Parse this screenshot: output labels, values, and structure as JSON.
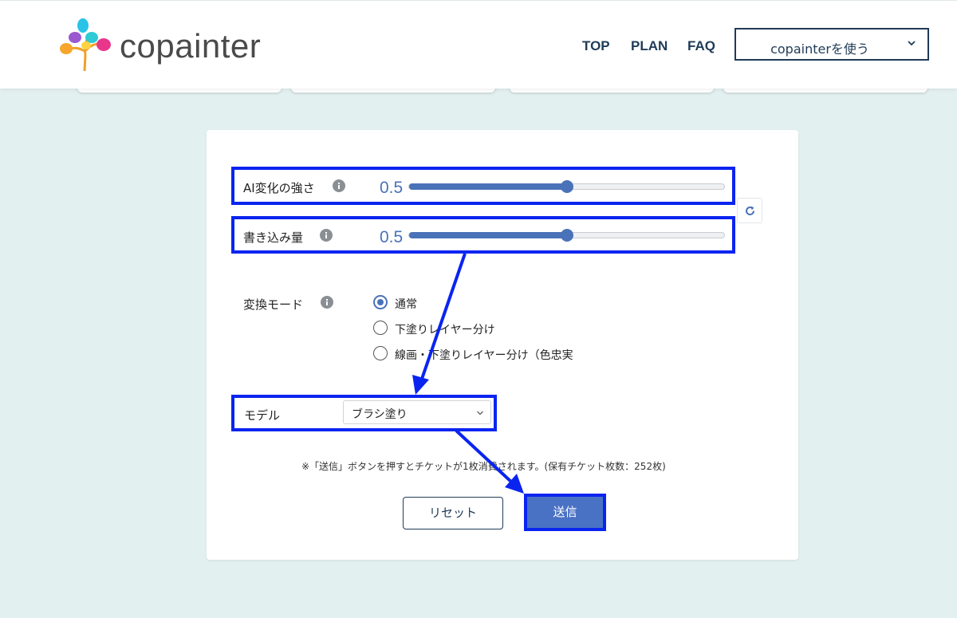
{
  "header": {
    "brand": "copainter",
    "nav": [
      "TOP",
      "PLAN",
      "FAQ"
    ],
    "use_button": "copainterを使う"
  },
  "form": {
    "ai_strength": {
      "label": "AI変化の強さ",
      "value": "0.5",
      "fraction": 0.5
    },
    "write_amount": {
      "label": "書き込み量",
      "value": "0.5",
      "fraction": 0.5
    },
    "mode": {
      "label": "変換モード",
      "options": [
        "通常",
        "下塗りレイヤー分け",
        "線画・下塗りレイヤー分け（色忠実"
      ],
      "selected_index": 0
    },
    "model": {
      "label": "モデル",
      "selected": "ブラシ塗り"
    },
    "note": "※「送信」ボタンを押すとチケットが1枚消費されます。(保有チケット枚数：252枚)",
    "reset_label": "リセット",
    "submit_label": "送信"
  },
  "colors": {
    "accent": "#4a72b8",
    "highlight": "#0a24f0",
    "navy": "#1f3b57",
    "background": "#e3f0f0"
  }
}
